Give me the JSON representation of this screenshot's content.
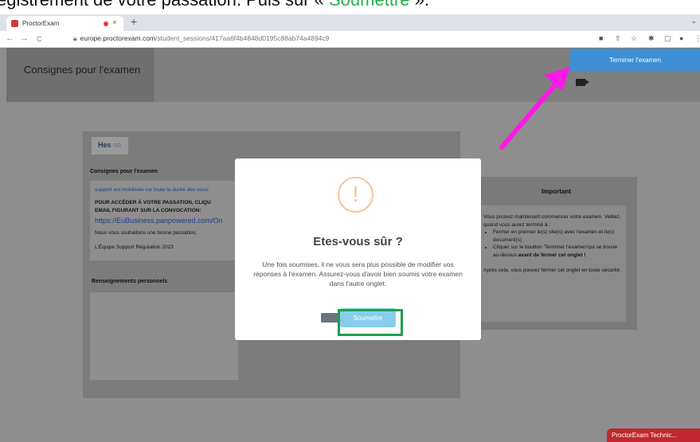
{
  "caption": {
    "prefix": "egistrement de votre passation. Puis sur « ",
    "highlight": "Soumettre",
    "suffix": " ».",
    "highlight_color": "#23b04a"
  },
  "browser": {
    "tab_title": "ProctorExam",
    "tab_close": "×",
    "new_tab": "+",
    "chevron": "⌄",
    "back": "←",
    "forward": "→",
    "reload": "C",
    "url_domain": "europe.proctorexam.com",
    "url_path": "/student_sessions/417aa6f4b4848d0195c88ab74a4894c9",
    "tools": [
      "■",
      "⇧",
      "☆",
      "✱",
      "▢",
      "●",
      "⋮"
    ]
  },
  "page": {
    "header_title": "Consignes pour l'examen",
    "end_exam_label": "Terminer l'examen",
    "logo_text": "Hes",
    "logo_suffix": "·so",
    "instructions_title": "Consignes pour l'examen",
    "instructions": {
      "line1": "support est mobilisée sur toute la durée des sessi",
      "line2": "POUR ACCÉDER À VOTRE PASSATION, CLIQU",
      "line3": "EMAIL FIGURANT SUR LA CONVOCATION:",
      "link": "https://EuBusiness.panpowered.com/On",
      "line5": "Nous vous souhaitons une bonne passation,",
      "line6": "L'Équipe Support Régulation 2023"
    },
    "personal_title": "Renseignements personnels",
    "important": {
      "title": "Important",
      "intro": "Vous pouvez maintenant commencer votre examen. Veillez, quand vous aurez terminé à :",
      "bullet1": "Fermer en premier le(s) site(s) avec l'examen et le(s) document(s)",
      "bullet2_a": "Cliquer sur le boutton 'Terminer l'examen'qui se trouve au-dessus ",
      "bullet2_b": "avant de fermer cet onglet !",
      "outro": "Après cela, vous pouvez fermer cet onglet en toute sécurité."
    },
    "chat_label": "ProctorExam Technic..."
  },
  "modal": {
    "icon": "!",
    "title": "Etes-vous sûr ?",
    "message": "Une fois soumises, il ne vous sera plus possible de modifier vos réponses à l'examen. Assurez-vous d'avoir bien soumis votre examen dans l'autre onglet.",
    "submit_label": "Soumettre"
  },
  "colors": {
    "overlay": "#8e8e8e",
    "end_button": "#3e8fd4",
    "submit_button": "#87ceeb",
    "highlight_box": "#1f9f50",
    "arrow": "#ff19e6",
    "warning_icon": "#f5c59c"
  }
}
